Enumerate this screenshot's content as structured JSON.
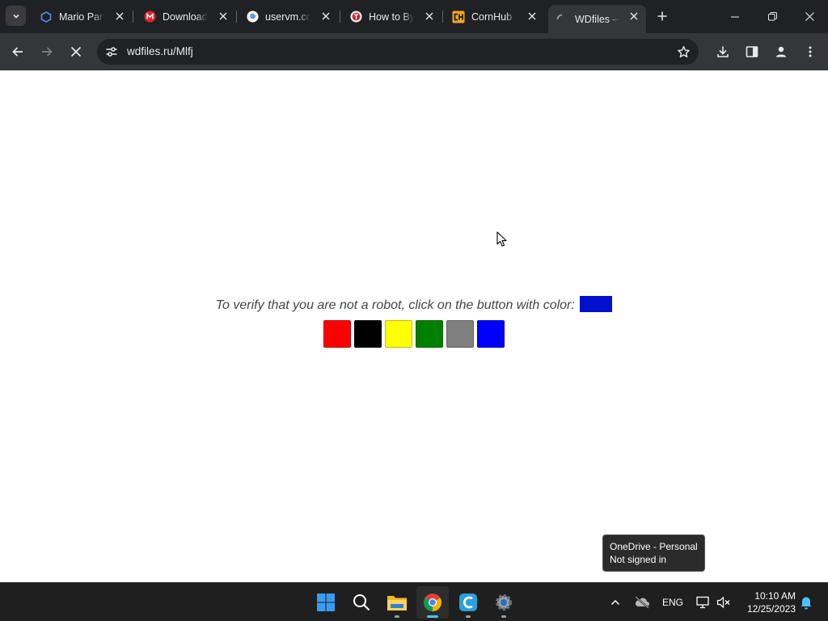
{
  "tabs": [
    {
      "title": "Mario Party",
      "icon": "hexagon-icon"
    },
    {
      "title": "Download",
      "icon": "mega-icon"
    },
    {
      "title": "uservm.com",
      "icon": "google-icon"
    },
    {
      "title": "How to Bypass",
      "icon": "hacker-icon"
    },
    {
      "title": "CornHub",
      "icon": "cornhub-icon"
    },
    {
      "title": "WDfiles —",
      "icon": "loading-spinner-icon",
      "active": true
    }
  ],
  "omnibox": {
    "url": "wdfiles.ru/Mlfj"
  },
  "page": {
    "prompt": "To verify that you are not a robot, click on the button with color:",
    "target_color": "#0010cc",
    "buttons": [
      {
        "name": "red",
        "color": "#ff0000"
      },
      {
        "name": "black",
        "color": "#000000"
      },
      {
        "name": "yellow",
        "color": "#ffff00"
      },
      {
        "name": "green",
        "color": "#008000"
      },
      {
        "name": "gray",
        "color": "#808080"
      },
      {
        "name": "blue",
        "color": "#0000ff"
      }
    ]
  },
  "tooltip": {
    "line1": "OneDrive - Personal",
    "line2": "Not signed in"
  },
  "taskbar": {
    "apps": [
      "start-icon",
      "search-icon",
      "file-explorer-icon",
      "chrome-icon",
      "ccleaner-icon",
      "settings-icon"
    ],
    "language": "ENG",
    "time": "10:10 AM",
    "date": "12/25/2023"
  }
}
